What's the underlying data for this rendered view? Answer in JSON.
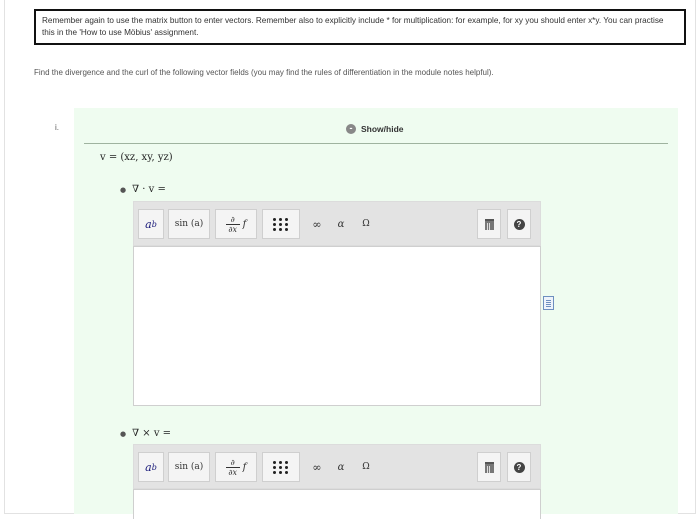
{
  "notice": {
    "text": "Remember again to use the matrix button to enter vectors. Remember also to explicitly include * for multiplication: for example, for xy you should enter x*y. You can practise this in the 'How to use Möbius' assignment."
  },
  "instruction": "Find the divergence and the curl of the following vector fields (you may find the rules of differentiation in the module notes helpful).",
  "question": {
    "number": "i.",
    "toggle_label": "Show/hide",
    "toggle_symbol": "-",
    "vector_field": "v = (xz, xy, yz)",
    "parts": [
      {
        "label": "∇ · v ="
      },
      {
        "label": "∇ × v ="
      }
    ]
  },
  "toolbar": {
    "power_base": "a",
    "power_exp": "b",
    "sin_label": "sin (a)",
    "deriv_num": "∂",
    "deriv_den": "∂x",
    "deriv_f": "f",
    "infinity": "∞",
    "alpha": "α",
    "omega": "Ω",
    "help": "?"
  },
  "icons": [
    "power-icon",
    "sin-icon",
    "derivative-icon",
    "matrix-icon",
    "infinity-icon",
    "alpha-icon",
    "omega-icon",
    "trash-icon",
    "help-icon",
    "document-icon"
  ]
}
